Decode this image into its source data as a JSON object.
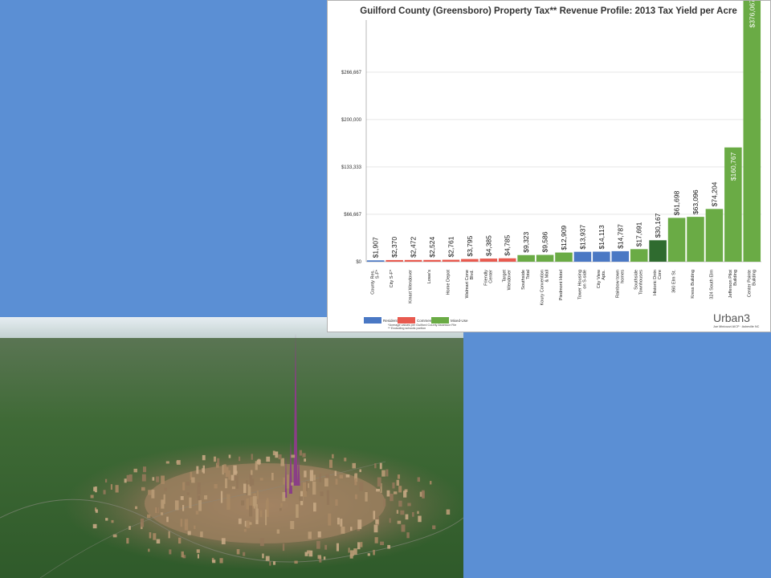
{
  "chart_data": {
    "type": "bar",
    "title": "Guilford County (Greensboro) Property Tax** Revenue Profile: 2013 Tax Yield per Acre",
    "categories": [
      "County Res. S-F*",
      "City S-F*",
      "Kmart Wendover",
      "Lowe's",
      "Home Depot",
      "Walmart Cone Blvd.",
      "Friendly Center",
      "Target Wendover",
      "Southside Total",
      "Koury Convention & Mall",
      "Piedmont Hotel",
      "Tower Housing on S-side",
      "City View Apts.",
      "Rainbow town homes",
      "Southside Townhouses",
      "Historic Dntn Core",
      "360 Elm St.",
      "Kress Building",
      "324 South Elm",
      "Jefferson Pilot Building",
      "Center Pointe Building"
    ],
    "values": [
      1907,
      2370,
      2472,
      2524,
      2761,
      3795,
      4385,
      4785,
      9323,
      9586,
      12909,
      13937,
      14113,
      14787,
      17691,
      30167,
      61698,
      63096,
      74204,
      160767,
      376067
    ],
    "labels": [
      "$1,907",
      "$2,370",
      "$2,472",
      "$2,524",
      "$2,761",
      "$3,795",
      "$4,385",
      "$4,785",
      "$9,323",
      "$9,586",
      "$12,909",
      "$13,937",
      "$14,113",
      "$14,787",
      "$17,691",
      "$30,167",
      "$61,698",
      "$63,096",
      "$74,204",
      "$160,767",
      "$376,067"
    ],
    "groups": [
      "Residential",
      "Commercial",
      "Commercial",
      "Commercial",
      "Commercial",
      "Commercial",
      "Commercial",
      "Commercial",
      "Mixed-Use",
      "Mixed-Use",
      "Mixed-Use",
      "Residential",
      "Residential",
      "Residential",
      "Mixed-Use",
      "Historic",
      "Mixed-Use",
      "Mixed-Use",
      "Mixed-Use",
      "Mixed-Use",
      "Mixed-Use"
    ],
    "colors": {
      "Residential": "#4a78c4",
      "Commercial": "#e85a4f",
      "Mixed-Use": "#6aab45",
      "Historic": "#2f6b2f"
    },
    "ylim": [
      0,
      340000
    ],
    "yticks": [
      0,
      66667,
      133333,
      200000,
      266667
    ],
    "ytick_labels": [
      "$0",
      "$66,667",
      "$133,333",
      "$200,000",
      "$266,667"
    ],
    "grid": true,
    "legend": [
      {
        "label": "Residential",
        "color": "#4a78c4"
      },
      {
        "label": "Commercial",
        "color": "#e85a4f"
      },
      {
        "label": "Mixed-Use",
        "color": "#6aab45"
      }
    ],
    "notes": [
      "*Average values per Guilford County Assessor File",
      "** Excluding schools portion"
    ],
    "logo": "Urban3",
    "logo_sub": "Joe Minicozzi AICP · Asheville NC"
  }
}
